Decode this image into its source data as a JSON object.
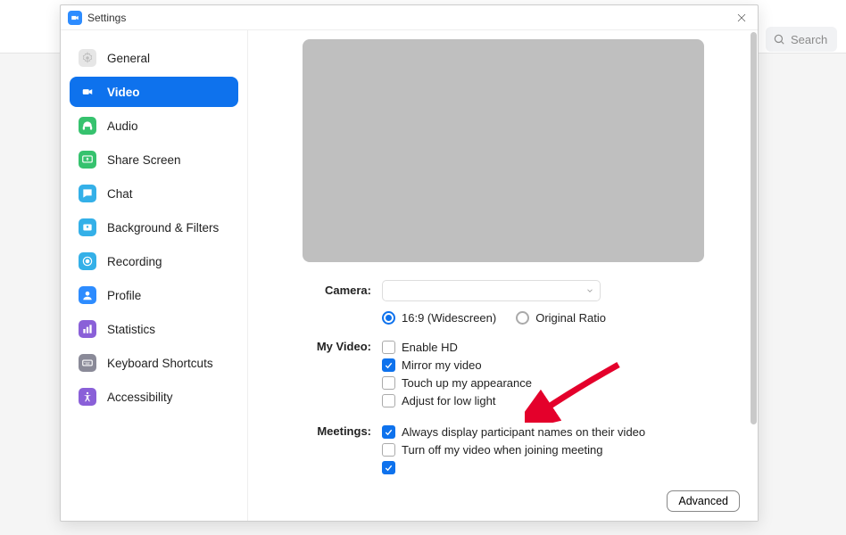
{
  "app": {
    "title": "Settings"
  },
  "search": {
    "placeholder": "Search"
  },
  "sidebar": {
    "items": [
      {
        "id": "general",
        "label": "General",
        "iconBg": "#e6e6e6",
        "iconFg": "#bdbdbd",
        "iconName": "gear-icon"
      },
      {
        "id": "video",
        "label": "Video",
        "iconBg": "#ffffff",
        "iconFg": "#ffffff",
        "iconName": "video-icon"
      },
      {
        "id": "audio",
        "label": "Audio",
        "iconBg": "#36c26e",
        "iconFg": "#ffffff",
        "iconName": "headphones-icon"
      },
      {
        "id": "share",
        "label": "Share Screen",
        "iconBg": "#36c26e",
        "iconFg": "#ffffff",
        "iconName": "share-screen-icon"
      },
      {
        "id": "chat",
        "label": "Chat",
        "iconBg": "#34b0e8",
        "iconFg": "#ffffff",
        "iconName": "chat-icon"
      },
      {
        "id": "bg",
        "label": "Background & Filters",
        "iconBg": "#34b0e8",
        "iconFg": "#ffffff",
        "iconName": "background-icon"
      },
      {
        "id": "recording",
        "label": "Recording",
        "iconBg": "#34b0e8",
        "iconFg": "#ffffff",
        "iconName": "record-icon"
      },
      {
        "id": "profile",
        "label": "Profile",
        "iconBg": "#2d8cff",
        "iconFg": "#ffffff",
        "iconName": "profile-icon"
      },
      {
        "id": "stats",
        "label": "Statistics",
        "iconBg": "#8a60d8",
        "iconFg": "#ffffff",
        "iconName": "statistics-icon"
      },
      {
        "id": "shortcuts",
        "label": "Keyboard Shortcuts",
        "iconBg": "#8a8a98",
        "iconFg": "#ffffff",
        "iconName": "keyboard-icon"
      },
      {
        "id": "accessibility",
        "label": "Accessibility",
        "iconBg": "#8a60d8",
        "iconFg": "#ffffff",
        "iconName": "accessibility-icon"
      }
    ],
    "activeId": "video"
  },
  "settings": {
    "cameraLabel": "Camera:",
    "cameraValue": "",
    "aspect": {
      "widescreen": "16:9 (Widescreen)",
      "original": "Original Ratio",
      "selected": "widescreen"
    },
    "myVideoLabel": "My Video:",
    "myVideo": [
      {
        "key": "enableHd",
        "label": "Enable HD",
        "checked": false
      },
      {
        "key": "mirror",
        "label": "Mirror my video",
        "checked": true
      },
      {
        "key": "touchup",
        "label": "Touch up my appearance",
        "checked": false
      },
      {
        "key": "lowlight",
        "label": "Adjust for low light",
        "checked": false
      }
    ],
    "meetingsLabel": "Meetings:",
    "meetings": [
      {
        "key": "names",
        "label": "Always display participant names on their video",
        "checked": true
      },
      {
        "key": "off",
        "label": "Turn off my video when joining meeting",
        "checked": false
      },
      {
        "key": "hidden",
        "label": "",
        "checked": true
      }
    ]
  },
  "buttons": {
    "advanced": "Advanced"
  }
}
